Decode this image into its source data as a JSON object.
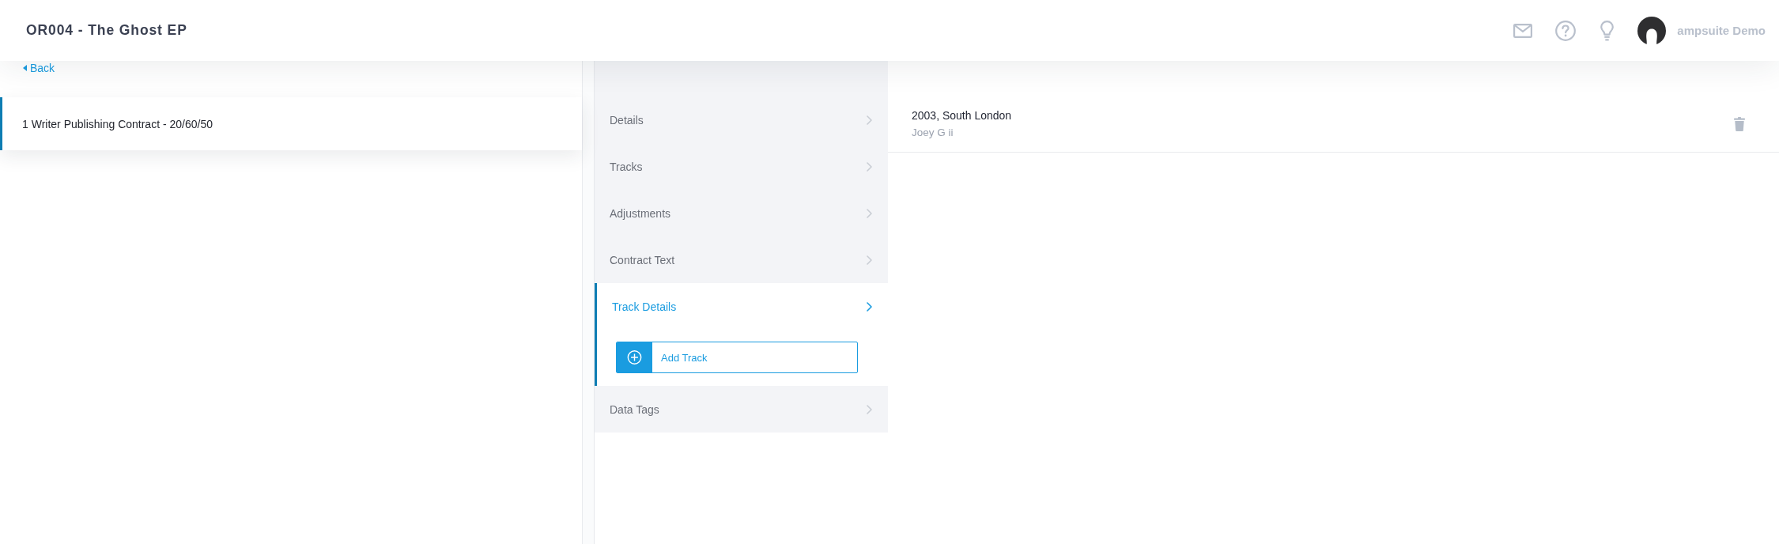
{
  "header": {
    "title": "OR004 - The Ghost EP",
    "user": {
      "name": "ampsuite Demo"
    }
  },
  "back_link": {
    "label": "Back"
  },
  "contracts": [
    {
      "label": "1 Writer Publishing Contract - 20/60/50",
      "selected": true
    }
  ],
  "sections": [
    {
      "label": "Details",
      "selected": false
    },
    {
      "label": "Tracks",
      "selected": false
    },
    {
      "label": "Adjustments",
      "selected": false
    },
    {
      "label": "Contract Text",
      "selected": false
    },
    {
      "label": "Track Details",
      "selected": true,
      "action": {
        "label": "Add Track"
      }
    },
    {
      "label": "Data Tags",
      "selected": false
    }
  ],
  "tracks": [
    {
      "title": "2003, South London",
      "subtitle": "Joey G ii"
    }
  ]
}
